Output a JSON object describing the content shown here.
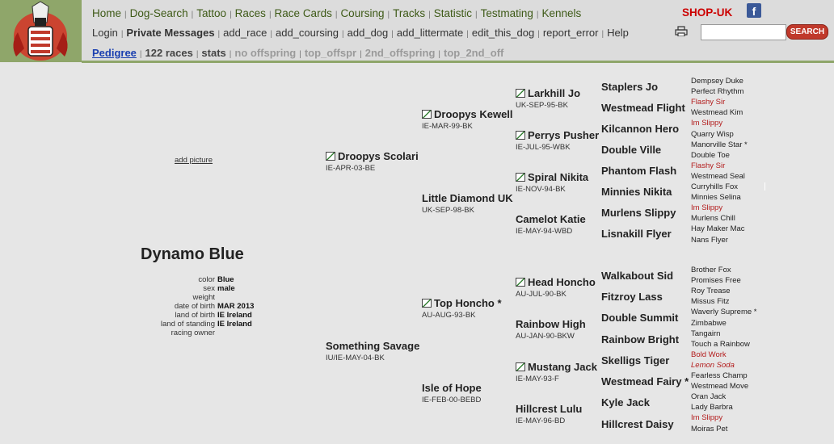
{
  "nav": {
    "main": [
      "Home",
      "Dog-Search",
      "Tattoo",
      "Races",
      "Race Cards",
      "Coursing",
      "Tracks",
      "Statistic",
      "Testmating",
      "Kennels"
    ],
    "shop": "SHOP-UK",
    "user": [
      "Login",
      "Private Messages",
      "add_race",
      "add_coursing",
      "add_dog",
      "add_littermate",
      "edit_this_dog",
      "report_error",
      "Help"
    ],
    "search_btn": "SEARCH",
    "tabs": [
      "Pedigree",
      "122 races",
      "stats",
      "no offspring",
      "top_offspr",
      "2nd_offspring",
      "top_2nd_off"
    ]
  },
  "dog": {
    "add_picture": "add picture",
    "name": "Dynamo Blue",
    "details": [
      {
        "label": "color",
        "value": "Blue"
      },
      {
        "label": "sex",
        "value": "male"
      },
      {
        "label": "weight",
        "value": ""
      },
      {
        "label": "date of birth",
        "value": "MAR 2013"
      },
      {
        "label": "land of birth",
        "value": "IE Ireland"
      },
      {
        "label": "land of standing",
        "value": "IE Ireland"
      },
      {
        "label": "racing owner",
        "value": ""
      }
    ]
  },
  "pedigree": {
    "g1": [
      {
        "name": "Droopys Scolari",
        "info": "IE-APR-03-BE",
        "icon": true
      },
      {
        "name": "Something Savage",
        "info": "IU/IE-MAY-04-BK",
        "icon": false
      }
    ],
    "g2": [
      {
        "name": "Droopys Kewell",
        "info": "IE-MAR-99-BK",
        "icon": true
      },
      {
        "name": "Little Diamond UK",
        "info": "UK-SEP-98-BK",
        "icon": false
      },
      {
        "name": "Top Honcho *",
        "info": "AU-AUG-93-BK",
        "icon": true
      },
      {
        "name": "Isle of Hope",
        "info": "IE-FEB-00-BEBD",
        "icon": false
      }
    ],
    "g3": [
      {
        "name": "Larkhill Jo",
        "info": "UK-SEP-95-BK",
        "icon": true
      },
      {
        "name": "Perrys Pusher",
        "info": "IE-JUL-95-WBK",
        "icon": true
      },
      {
        "name": "Spiral Nikita",
        "info": "IE-NOV-94-BK",
        "icon": true
      },
      {
        "name": "Camelot Katie",
        "info": "IE-MAY-94-WBD",
        "icon": false
      },
      {
        "name": "Head Honcho",
        "info": "AU-JUL-90-BK",
        "icon": true
      },
      {
        "name": "Rainbow High",
        "info": "AU-JAN-90-BKW",
        "icon": false
      },
      {
        "name": "Mustang Jack",
        "info": "IE-MAY-93-F",
        "icon": true
      },
      {
        "name": "Hillcrest Lulu",
        "info": "IE-MAY-96-BD",
        "icon": false
      }
    ],
    "g4": [
      "Staplers Jo",
      "Westmead Flight",
      "Kilcannon Hero",
      "Double Ville",
      "Phantom Flash",
      "Minnies Nikita",
      "Murlens Slippy",
      "Lisnakill Flyer",
      "Walkabout Sid",
      "Fitzroy Lass",
      "Double Summit",
      "Rainbow Bright",
      "Skelligs Tiger",
      "Westmead Fairy *",
      "Kyle Jack",
      "Hillcrest Daisy"
    ],
    "g5": [
      {
        "name": "Dempsey Duke",
        "style": ""
      },
      {
        "name": "Perfect Rhythm",
        "style": ""
      },
      {
        "name": "Flashy Sir",
        "style": "red"
      },
      {
        "name": "Westmead Kim",
        "style": ""
      },
      {
        "name": "Im Slippy",
        "style": "red"
      },
      {
        "name": "Quarry Wisp",
        "style": ""
      },
      {
        "name": "Manorville Star *",
        "style": ""
      },
      {
        "name": "Double Toe",
        "style": ""
      },
      {
        "name": "Flashy Sir",
        "style": "red"
      },
      {
        "name": "Westmead Seal",
        "style": ""
      },
      {
        "name": "Curryhills Fox",
        "style": ""
      },
      {
        "name": "Minnies Selina",
        "style": ""
      },
      {
        "name": "Im Slippy",
        "style": "red"
      },
      {
        "name": "Murlens Chill",
        "style": ""
      },
      {
        "name": "Hay Maker Mac",
        "style": ""
      },
      {
        "name": "Nans Flyer",
        "style": ""
      },
      {
        "name": "Brother Fox",
        "style": ""
      },
      {
        "name": "Promises Free",
        "style": ""
      },
      {
        "name": "Roy Trease",
        "style": ""
      },
      {
        "name": "Missus Fitz",
        "style": ""
      },
      {
        "name": "Waverly Supreme *",
        "style": ""
      },
      {
        "name": "Zimbabwe",
        "style": ""
      },
      {
        "name": "Tangairn",
        "style": ""
      },
      {
        "name": "Touch a Rainbow",
        "style": ""
      },
      {
        "name": "Bold Work",
        "style": "red"
      },
      {
        "name": "Lemon Soda",
        "style": "redi"
      },
      {
        "name": "Fearless Champ",
        "style": ""
      },
      {
        "name": "Westmead Move",
        "style": ""
      },
      {
        "name": "Oran Jack",
        "style": ""
      },
      {
        "name": "Lady Barbra",
        "style": ""
      },
      {
        "name": "Im Slippy",
        "style": "red"
      },
      {
        "name": "Moiras Pet",
        "style": ""
      }
    ]
  }
}
